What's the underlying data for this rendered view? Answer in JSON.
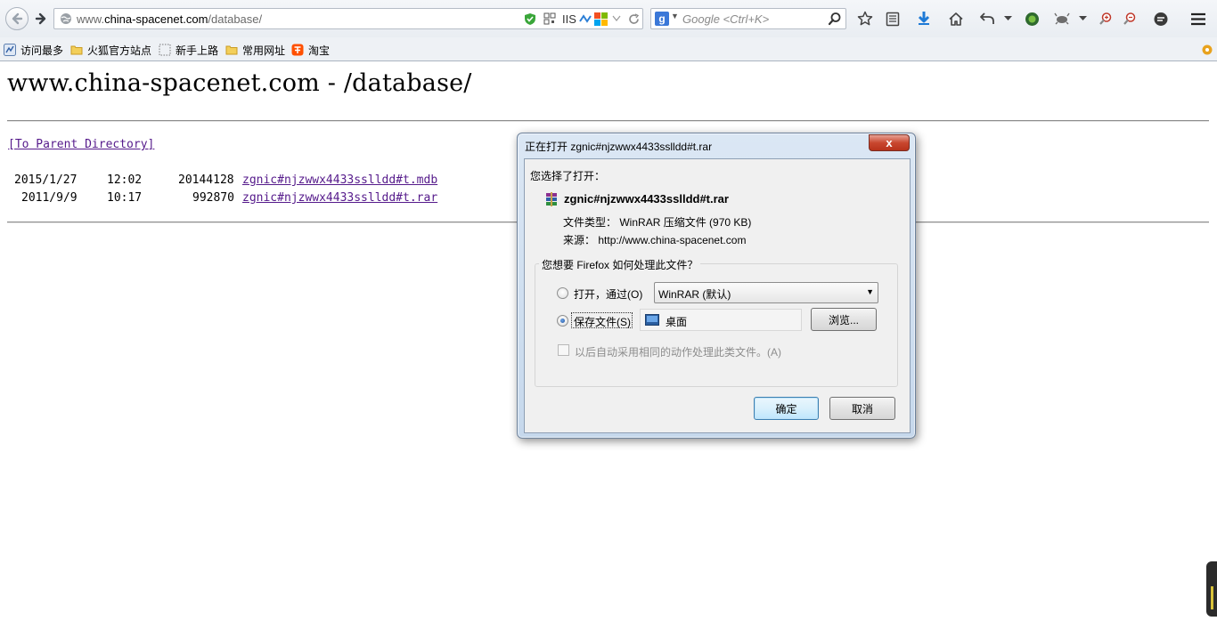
{
  "browser": {
    "url_prefix": "www.",
    "url_host": "china-spacenet.com",
    "url_path": "/database/",
    "iis_label": "IIS",
    "search_engine_letter": "g",
    "search_placeholder": "Google <Ctrl+K>"
  },
  "bookmarks": [
    {
      "label": "访问最多"
    },
    {
      "label": "火狐官方站点"
    },
    {
      "label": "新手上路"
    },
    {
      "label": "常用网址"
    },
    {
      "label": "淘宝"
    }
  ],
  "page": {
    "title": "www.china-spacenet.com - /database/",
    "parent_link": "[To Parent Directory]",
    "files": [
      {
        "date": "2015/1/27",
        "time": "12:02",
        "size": "20144128",
        "name": "zgnic#njzwwx4433sslldd#t.mdb"
      },
      {
        "date": "2011/9/9",
        "time": "10:17",
        "size": "992870",
        "name": "zgnic#njzwwx4433sslldd#t.rar"
      }
    ]
  },
  "dialog": {
    "title": "正在打开 zgnic#njzwwx4433sslldd#t.rar",
    "close_label": "x",
    "chosen_label": "您选择了打开：",
    "file_name": "zgnic#njzwwx4433sslldd#t.rar",
    "type_key": "文件类型：",
    "type_value": "WinRAR 压缩文件 (970 KB)",
    "source_key": "来源：",
    "source_value": "http://www.china-spacenet.com",
    "group_label": "您想要 Firefox 如何处理此文件？",
    "open_with_label": "打开，通过(O)",
    "open_with_app": "WinRAR (默认)",
    "save_label": "保存文件(S)",
    "save_folder": "桌面",
    "browse_label": "浏览...",
    "auto_label": "以后自动采用相同的动作处理此类文件。(A)",
    "ok_label": "确定",
    "cancel_label": "取消"
  }
}
